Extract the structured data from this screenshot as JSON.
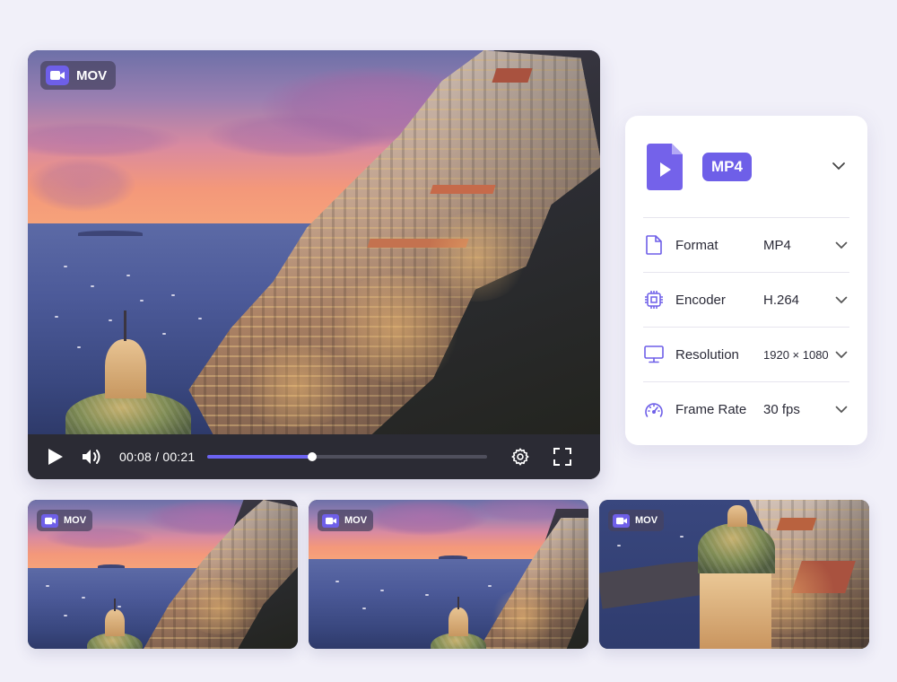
{
  "main_video": {
    "format_badge": "MOV",
    "badge_icon": "video-camera-icon",
    "time_current": "00:08",
    "time_separator": "/",
    "time_total": "00:21",
    "progress": 0.375
  },
  "output_panel": {
    "selected_format": "MP4",
    "header_icon": "video-file-icon",
    "settings": [
      {
        "label": "Format",
        "value": "MP4",
        "icon": "document-icon"
      },
      {
        "label": "Encoder",
        "value": "H.264",
        "icon": "chip-icon"
      },
      {
        "label": "Resolution",
        "value": "1920 × 1080",
        "icon": "monitor-icon"
      },
      {
        "label": "Frame Rate",
        "value": "30 fps",
        "icon": "speedometer-icon"
      }
    ]
  },
  "thumbnails": [
    {
      "format_badge": "MOV"
    },
    {
      "format_badge": "MOV"
    },
    {
      "format_badge": "MOV"
    }
  ],
  "colors": {
    "accent": "#6e5fe8",
    "progress": "#6c63f2",
    "background": "#f1f0f9",
    "control_bar": "#2b2b34"
  }
}
